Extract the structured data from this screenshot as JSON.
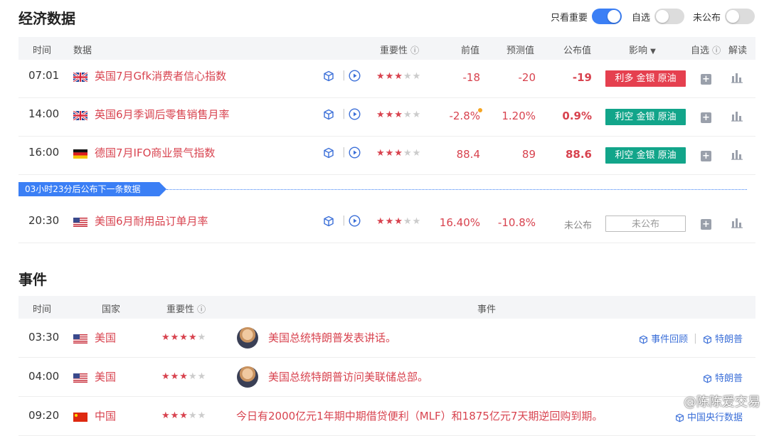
{
  "data_section": {
    "title": "经济数据",
    "toggles": [
      {
        "label": "只看重要",
        "on": true
      },
      {
        "label": "自选",
        "on": false
      },
      {
        "label": "未公布",
        "on": false
      }
    ],
    "columns": {
      "time": "时间",
      "data": "数据",
      "importance": "重要性",
      "previous": "前值",
      "forecast": "预测值",
      "actual": "公布值",
      "impact": "影响",
      "watch": "自选",
      "analysis": "解读"
    },
    "rows": [
      {
        "time": "07:01",
        "flag": "uk",
        "name": "英国7月Gfk消费者信心指数",
        "stars": 3,
        "previous": "-18",
        "forecast": "-20",
        "actual": "-19",
        "impact": "利多 金银 原油",
        "impact_type": "red"
      },
      {
        "time": "14:00",
        "flag": "uk",
        "name": "英国6月季调后零售销售月率",
        "stars": 3,
        "previous": "-2.8%",
        "forecast": "1.20%",
        "actual": "0.9%",
        "impact": "利空 金银 原油",
        "impact_type": "green"
      },
      {
        "time": "16:00",
        "flag": "de",
        "name": "德国7月IFO商业景气指数",
        "stars": 3,
        "previous": "88.4",
        "forecast": "89",
        "actual": "88.6",
        "impact": "利空 金银 原油",
        "impact_type": "green"
      },
      {
        "time": "20:30",
        "flag": "us",
        "name": "美国6月耐用品订单月率",
        "stars": 3,
        "previous": "16.40%",
        "forecast": "-10.8%",
        "actual": "未公布",
        "impact": "未公布",
        "impact_type": "empty"
      }
    ],
    "banner": "03小时23分后公布下一条数据"
  },
  "events_section": {
    "title": "事件",
    "columns": {
      "time": "时间",
      "country": "国家",
      "importance": "重要性",
      "event": "事件"
    },
    "rows": [
      {
        "time": "03:30",
        "flag": "us",
        "country": "美国",
        "stars": 4,
        "text": "美国总统特朗普发表讲话。",
        "links": [
          "事件回顾",
          "特朗普"
        ]
      },
      {
        "time": "04:00",
        "flag": "us",
        "country": "美国",
        "stars": 3,
        "text": "美国总统特朗普访问美联储总部。",
        "links": [
          "特朗普"
        ]
      },
      {
        "time": "09:20",
        "flag": "cn",
        "country": "中国",
        "stars": 3,
        "text": "今日有2000亿元1年期中期借贷便利（MLF）和1875亿元7天期逆回购到期。",
        "links": [
          "中国央行数据"
        ]
      }
    ]
  },
  "watermark": "@陈陈爱交易",
  "colors": {
    "accent": "#3b7ff5",
    "red": "#e5404f",
    "green": "#12a58a",
    "text_red": "#d8434f"
  }
}
